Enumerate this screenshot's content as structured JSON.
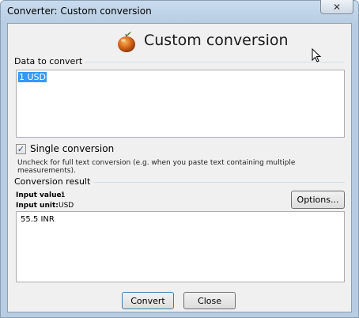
{
  "window": {
    "title": "Converter: Custom conversion",
    "close_glyph": "✕"
  },
  "header": {
    "title": "Custom conversion",
    "logo_icon": "orange-fruit-icon"
  },
  "data_group": {
    "label": "Data to convert",
    "input_value": "1 USD"
  },
  "single_conversion": {
    "checked": true,
    "check_glyph": "✓",
    "label": "Single conversion",
    "hint": "Uncheck for full text conversion (e.g. when you paste text containing multiple measurements)."
  },
  "result_group": {
    "label": "Conversion result",
    "input_value_label": "Input value:",
    "input_value": "1",
    "input_unit_label": "Input unit:",
    "input_unit": "USD",
    "options_label": "Options...",
    "result_text": "55.5 INR"
  },
  "buttons": {
    "convert_label": "Convert",
    "close_label": "Close"
  },
  "colors": {
    "title_bar": "#c9dcee",
    "selection": "#3399ff",
    "client_bg": "#f0f0f0"
  }
}
